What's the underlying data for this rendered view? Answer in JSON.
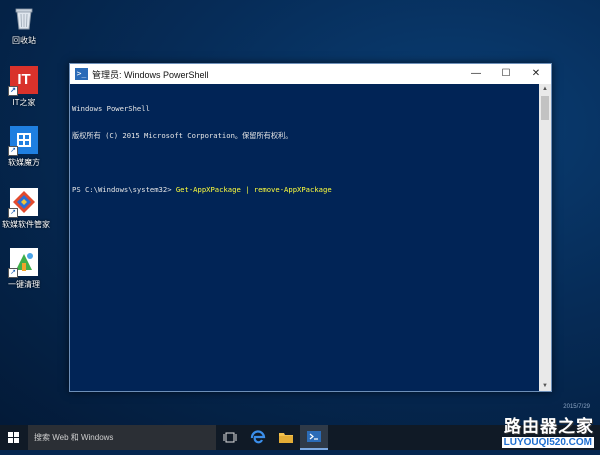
{
  "desktop": {
    "icons": [
      {
        "label": "回收站",
        "icon": "recycle-bin-icon"
      },
      {
        "label": "IT之家",
        "icon": "ithome-icon",
        "glyph_text": "IT"
      },
      {
        "label": "软媒魔方",
        "icon": "ruanmei-mofang-icon"
      },
      {
        "label": "软媒软件管家",
        "icon": "software-manager-icon"
      },
      {
        "label": "一键清理",
        "icon": "one-click-clean-icon"
      }
    ]
  },
  "window": {
    "title": "管理员: Windows PowerShell",
    "minimize": "—",
    "maximize": "☐",
    "close": "✕",
    "console": {
      "lines": [
        "Windows PowerShell",
        "版权所有 (C) 2015 Microsoft Corporation。保留所有权利。",
        ""
      ],
      "prompt": "PS C:\\Windows\\system32> ",
      "command": "Get-AppXPackage | remove-AppXPackage"
    }
  },
  "taskbar": {
    "search_placeholder": "搜索 Web 和 Windows",
    "colors": {
      "accent": "#7aa7e0"
    }
  },
  "watermark": {
    "title": "路由器之家",
    "url": "LUYOUQI520.COM",
    "small": "2015/7/29"
  }
}
